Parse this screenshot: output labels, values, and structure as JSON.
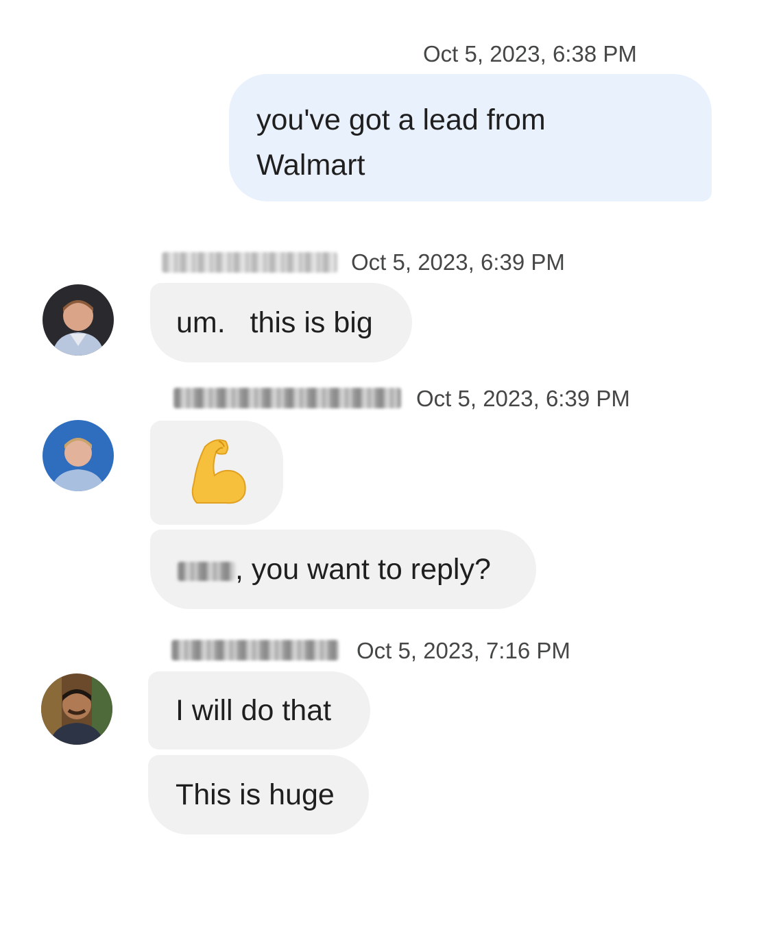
{
  "messages": [
    {
      "timestamp": "Oct 5, 2023, 6:38 PM",
      "text_line1": "you've got a lead from",
      "text_line2": "Walmart"
    },
    {
      "timestamp": "Oct 5, 2023, 6:39 PM",
      "text": "um.   this is big"
    },
    {
      "timestamp": "Oct 5, 2023, 6:39 PM",
      "emoji": "💪",
      "text_suffix": ", you want to reply?"
    },
    {
      "timestamp": "Oct 5, 2023, 7:16 PM",
      "text1": "I will do that",
      "text2": "This is huge"
    }
  ],
  "colors": {
    "outgoing_bubble": "#e9f1fd",
    "incoming_bubble": "#f1f1f1",
    "timestamp_text": "#444746",
    "message_text": "#1f1f1f"
  },
  "icons": [
    "flexed-biceps-emoji",
    "avatar-person"
  ]
}
